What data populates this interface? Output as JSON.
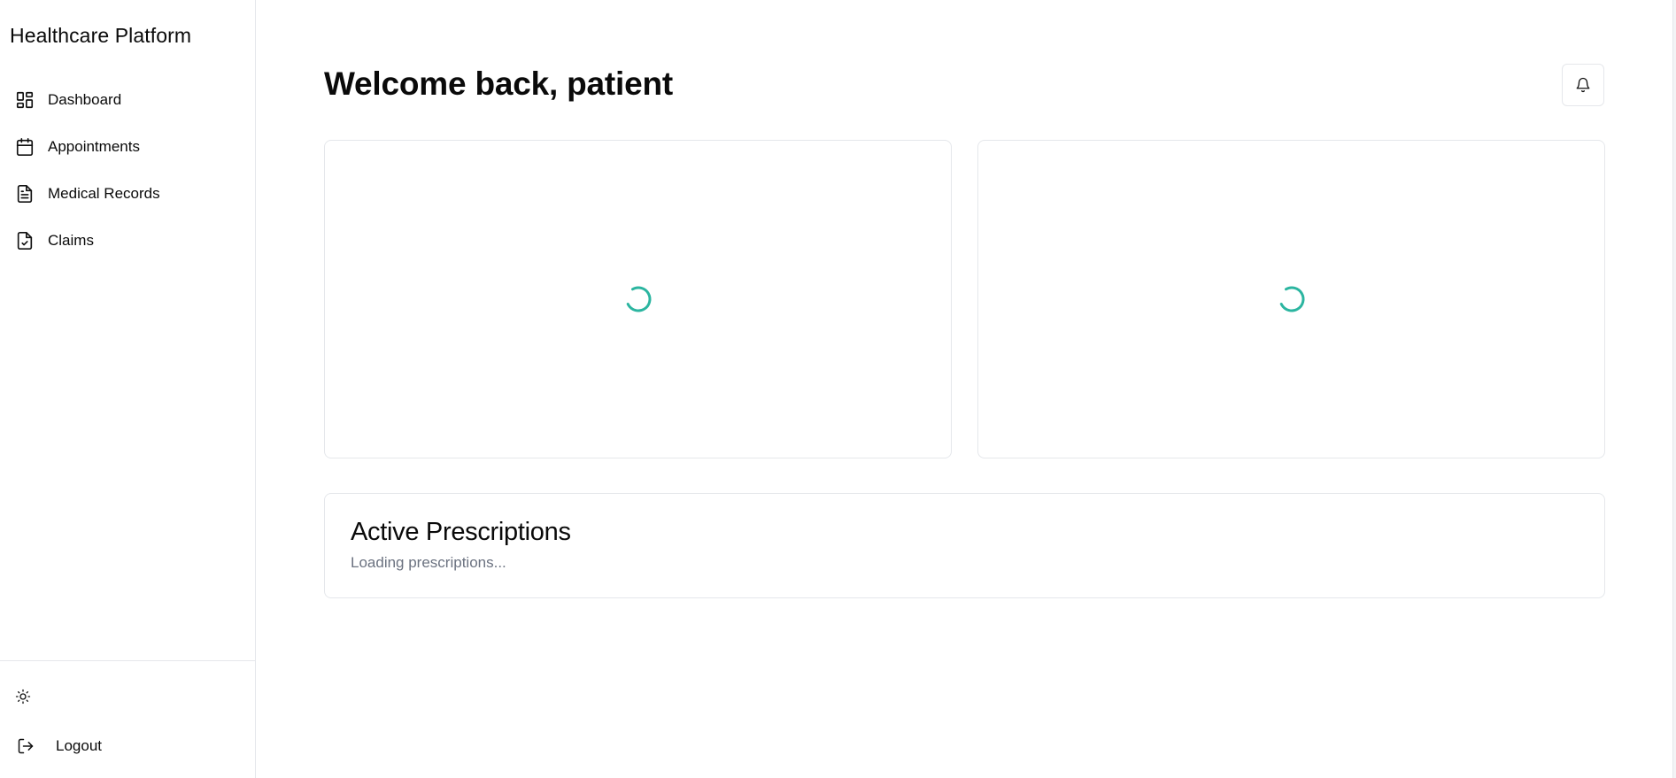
{
  "sidebar": {
    "brand": "Healthcare Platform",
    "items": [
      {
        "label": "Dashboard",
        "icon": "layout-dashboard-icon"
      },
      {
        "label": "Appointments",
        "icon": "calendar-icon"
      },
      {
        "label": "Medical Records",
        "icon": "file-text-icon"
      },
      {
        "label": "Claims",
        "icon": "file-check-icon"
      }
    ],
    "theme_toggle_icon": "sun-icon",
    "logout_label": "Logout",
    "logout_icon": "log-out-icon"
  },
  "header": {
    "title": "Welcome back, patient",
    "notification_icon": "bell-icon"
  },
  "cards": {
    "left_state": "loading",
    "right_state": "loading",
    "prescriptions_title": "Active Prescriptions",
    "prescriptions_status": "Loading prescriptions..."
  },
  "colors": {
    "accent": "#2bb5a0",
    "border": "#e5e7eb",
    "muted_text": "#6b7280"
  }
}
